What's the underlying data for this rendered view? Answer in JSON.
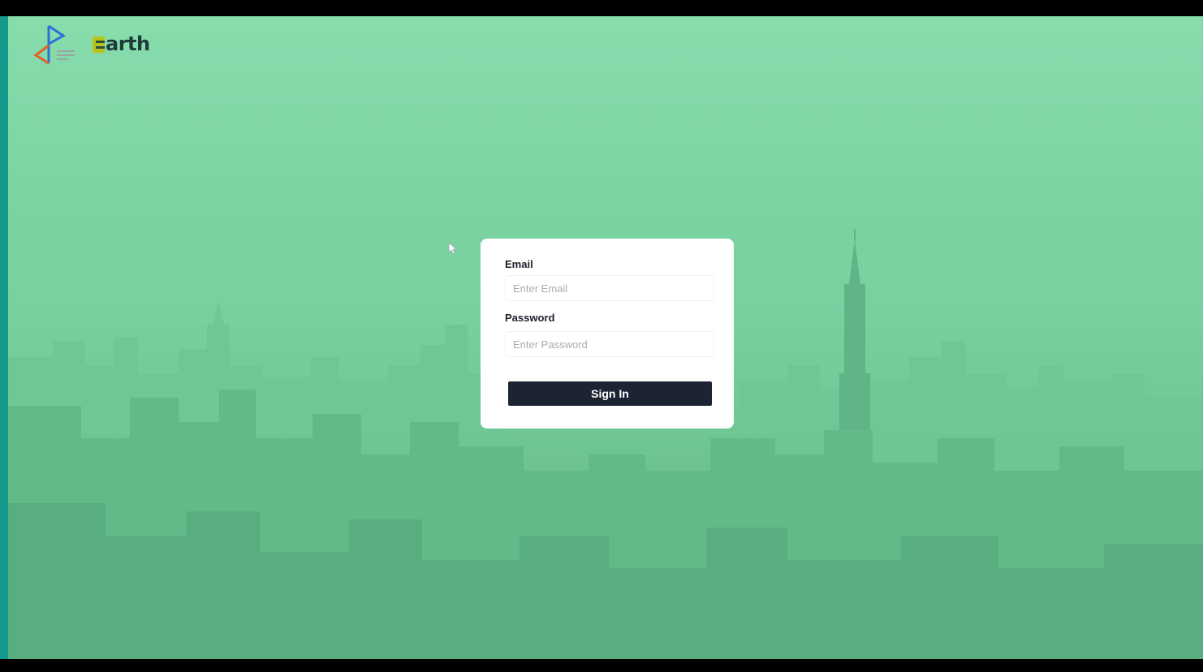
{
  "brand": {
    "logo_icon": "flag-triangle-logo-icon",
    "name_letter": "E",
    "name_rest": "arth"
  },
  "login_form": {
    "email_label": "Email",
    "email_placeholder": "Enter Email",
    "email_value": "",
    "password_label": "Password",
    "password_placeholder": "Enter Password",
    "password_value": "",
    "submit_label": "Sign In"
  },
  "background": {
    "description_icon": "city-skyline-image",
    "tint_color": "#7ed6a4"
  },
  "colors": {
    "button": "#1c2433",
    "card": "#ffffff",
    "accent_strip": "#139a8c"
  }
}
